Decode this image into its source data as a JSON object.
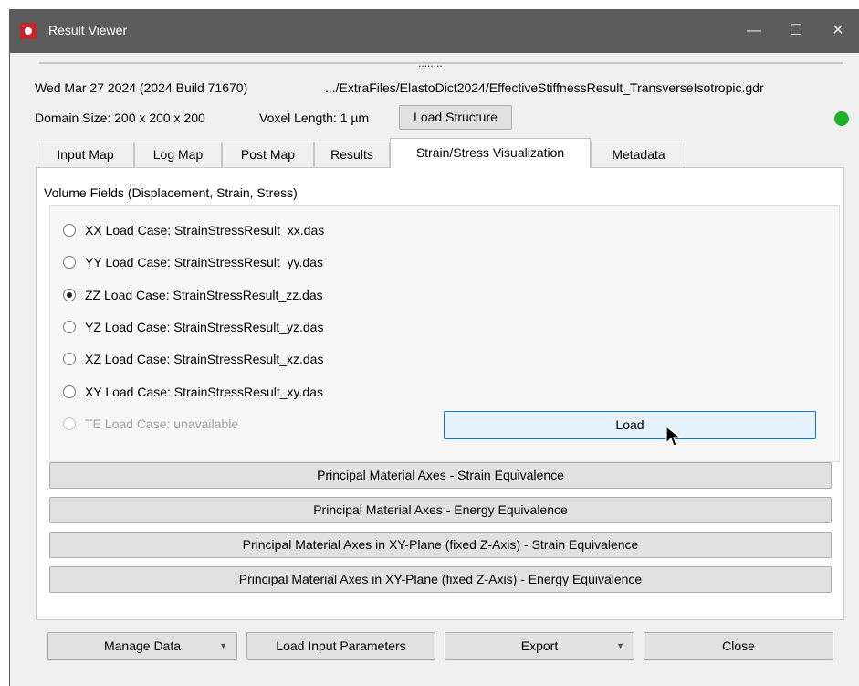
{
  "window": {
    "title": "Result Viewer",
    "controls": [
      "—",
      "☐",
      "✕"
    ]
  },
  "header": {
    "handle_dots": "........",
    "date_build": "Wed Mar 27 2024 (2024 Build 71670)",
    "file_path": ".../ExtraFiles/ElastoDict2024/EffectiveStiffnessResult_TransverseIsotropic.gdr",
    "domain_size": "Domain Size: 200 x 200 x 200",
    "voxel_length": "Voxel Length: 1 µm",
    "load_structure_label": "Load Structure",
    "status_color": "#1eb324"
  },
  "tabs": [
    {
      "label": "Input Map",
      "active": false
    },
    {
      "label": "Log Map",
      "active": false
    },
    {
      "label": "Post Map",
      "active": false
    },
    {
      "label": "Results",
      "active": false
    },
    {
      "label": "Strain/Stress Visualization",
      "active": true
    },
    {
      "label": "Metadata",
      "active": false
    }
  ],
  "volume_fields": {
    "title": "Volume Fields (Displacement, Strain, Stress)",
    "options": [
      {
        "label": "XX Load Case: StrainStressResult_xx.das",
        "checked": false,
        "enabled": true
      },
      {
        "label": "YY Load Case: StrainStressResult_yy.das",
        "checked": false,
        "enabled": true
      },
      {
        "label": "ZZ Load Case: StrainStressResult_zz.das",
        "checked": true,
        "enabled": true
      },
      {
        "label": "YZ Load Case: StrainStressResult_yz.das",
        "checked": false,
        "enabled": true
      },
      {
        "label": "XZ Load Case: StrainStressResult_xz.das",
        "checked": false,
        "enabled": true
      },
      {
        "label": "XY Load Case: StrainStressResult_xy.das",
        "checked": false,
        "enabled": true
      },
      {
        "label": "TE Load Case:  unavailable",
        "checked": false,
        "enabled": false
      }
    ],
    "load_label": "Load"
  },
  "axes_buttons": [
    "Principal Material Axes - Strain Equivalence",
    "Principal Material Axes - Energy Equivalence",
    "Principal Material Axes in XY-Plane (fixed Z-Axis) - Strain Equivalence",
    "Principal Material Axes in XY-Plane (fixed Z-Axis) - Energy Equivalence"
  ],
  "footer": {
    "manage_data": "Manage Data",
    "load_input_parameters": "Load Input Parameters",
    "export": "Export",
    "close": "Close"
  }
}
